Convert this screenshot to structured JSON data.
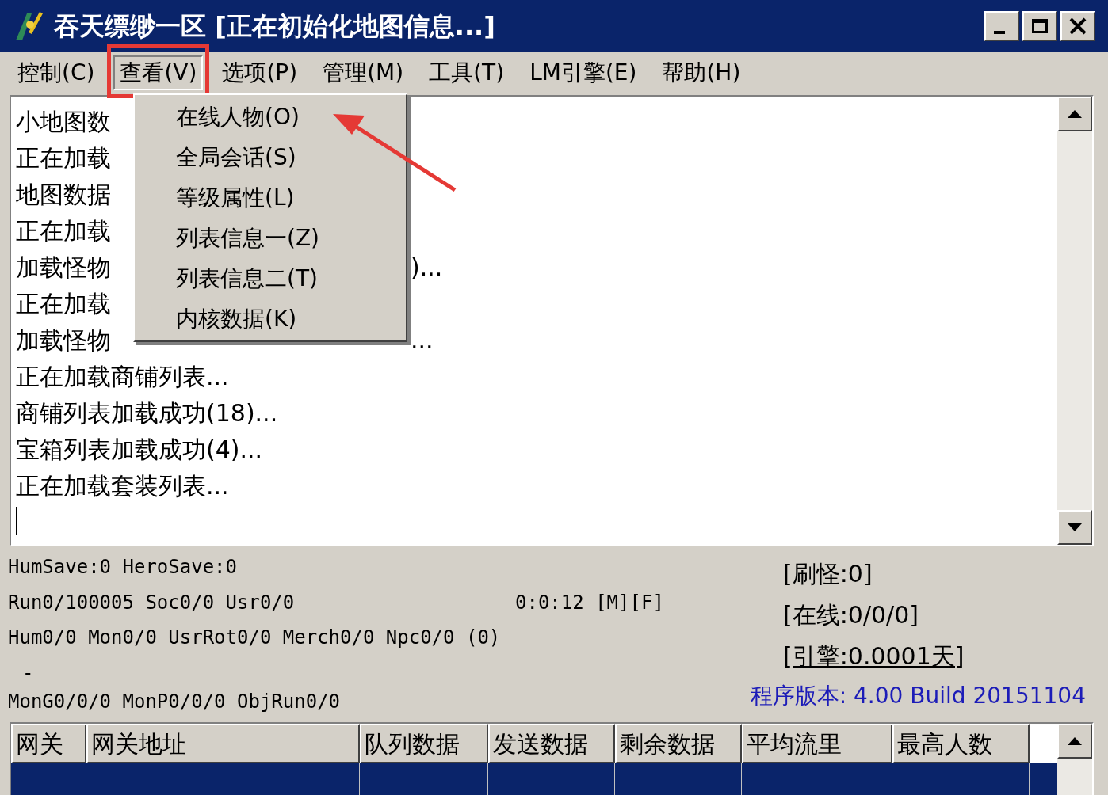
{
  "window": {
    "title": "吞天缥缈一区 [正在初始化地图信息...]"
  },
  "menu_bar": [
    {
      "label": "控制(C)",
      "selected": false
    },
    {
      "label": "查看(V)",
      "selected": true
    },
    {
      "label": "选项(P)",
      "selected": false
    },
    {
      "label": "管理(M)",
      "selected": false
    },
    {
      "label": "工具(T)",
      "selected": false
    },
    {
      "label": "LM引擎(E)",
      "selected": false
    },
    {
      "label": "帮助(H)",
      "selected": false
    }
  ],
  "open_menu": {
    "items": [
      "在线人物(O)",
      "全局会话(S)",
      "等级属性(L)",
      "列表信息一(Z)",
      "列表信息二(T)",
      "内核数据(K)"
    ]
  },
  "log": {
    "lines": [
      {
        "left": "小地图数"
      },
      {
        "left": "正在加载"
      },
      {
        "left": "地图数据"
      },
      {
        "left": "正在加载"
      },
      {
        "left": "加载怪物",
        "right": ")..."
      },
      {
        "left": "正在加载"
      },
      {
        "left": "加载怪物",
        "right": "..."
      },
      {
        "left": "正在加载商铺列表..."
      },
      {
        "left": "商铺列表加载成功(18)..."
      },
      {
        "left": "宝箱列表加载成功(4)..."
      },
      {
        "left": "正在加载套装列表..."
      }
    ]
  },
  "status": {
    "lines": [
      "HumSave:0 HeroSave:0",
      "Run0/100005 Soc0/0 Usr0/0",
      "Hum0/0 Mon0/0 UsrRot0/0 Merch0/0 Npc0/0 (0)",
      "-",
      "MonG0/0/0 MonP0/0/0 ObjRun0/0"
    ],
    "time": "0:0:12 [M][F]",
    "counters": [
      "[刷怪:0]",
      "[在线:0/0/0]"
    ],
    "engine": "[引擎:0.0001天]",
    "version": "程序版本: 4.00 Build 20151104"
  },
  "table": {
    "columns": [
      "网关",
      "网关地址",
      "队列数据",
      "发送数据",
      "剩余数据",
      "平均流里",
      "最高人数"
    ],
    "rows": [
      {
        "selected": true
      }
    ]
  }
}
